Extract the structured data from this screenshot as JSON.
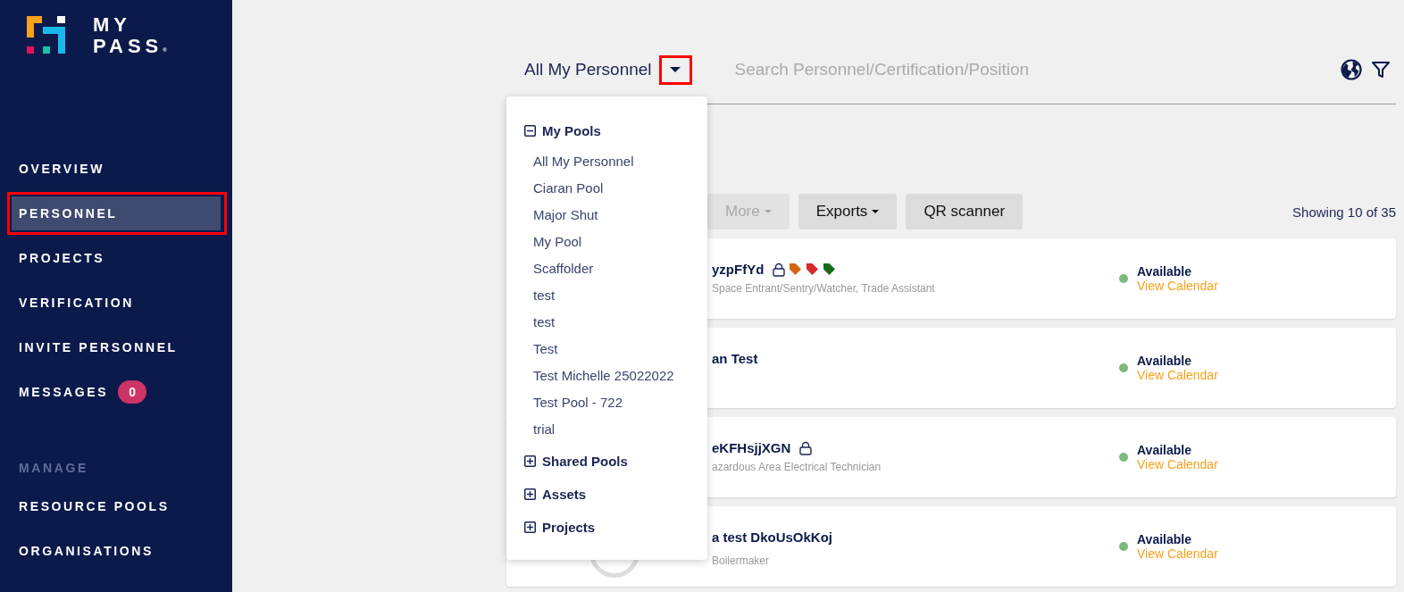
{
  "sidebar": {
    "logo": {
      "line_1": "MY",
      "line_2": "PASS",
      "mark": "®"
    },
    "items": [
      {
        "label": "OVERVIEW",
        "selected": false
      },
      {
        "label": "PERSONNEL",
        "selected": true
      },
      {
        "label": "PROJECTS",
        "selected": false
      },
      {
        "label": "VERIFICATION",
        "selected": false
      },
      {
        "label": "INVITE PERSONNEL",
        "selected": false
      },
      {
        "label": "MESSAGES",
        "selected": false,
        "badge": "0"
      }
    ],
    "section": "MANAGE",
    "manage_items": [
      {
        "label": "RESOURCE POOLS",
        "selected": false
      },
      {
        "label": "ORGANISATIONS",
        "selected": false
      }
    ]
  },
  "filter": {
    "pool": "All My Personnel",
    "search_placeholder": "Search Personnel/Certification/Position"
  },
  "dropdown": {
    "groups": [
      {
        "label": "My Pools",
        "expanded": true,
        "items": [
          "All My Personnel",
          "Ciaran Pool",
          "Major Shut",
          "My Pool",
          "Scaffolder",
          "test",
          "test",
          "Test",
          "Test Michelle 25022022",
          "Test Pool - 722",
          "trial"
        ]
      },
      {
        "label": "Shared Pools",
        "expanded": false
      },
      {
        "label": "Assets",
        "expanded": false
      },
      {
        "label": "Projects",
        "expanded": false
      }
    ]
  },
  "toolbar": {
    "buttons": [
      {
        "label": "More",
        "disabled": true,
        "caret": true
      },
      {
        "label": "Exports",
        "disabled": false,
        "caret": true
      },
      {
        "label": "QR scanner",
        "disabled": false,
        "caret": false
      }
    ],
    "count": "Showing 10 of 35"
  },
  "people": [
    {
      "name": "yzpFfYd",
      "locked": true,
      "tags": [
        {
          "color": "#d4650f"
        },
        {
          "color": "#d62b2b"
        },
        {
          "color": "#1a6a1a"
        }
      ],
      "roles": "Space Entrant/Sentry/Watcher, Trade Assistant",
      "status": "Available",
      "color": "#7cba7c",
      "calendar": "View Calendar"
    },
    {
      "name": "an Test",
      "locked": false,
      "status": "Available",
      "color": "#7cba7c",
      "calendar": "View Calendar"
    },
    {
      "name": "eKFHsjjXGN",
      "locked": true,
      "roles": "azardous Area Electrical Technician",
      "status": "Available",
      "color": "#7cba7c",
      "calendar": "View Calendar"
    },
    {
      "name": "a test DkoUsOkKoj",
      "locked": false,
      "roles": "Boilermaker",
      "status": "Available",
      "color": "#7cba7c",
      "calendar": "View Calendar"
    }
  ]
}
